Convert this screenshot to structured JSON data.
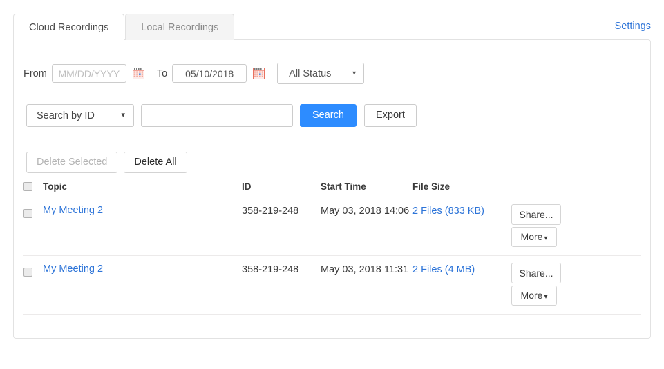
{
  "tabs": [
    {
      "label": "Cloud Recordings",
      "active": true
    },
    {
      "label": "Local Recordings",
      "active": false
    }
  ],
  "settings_link": "Settings",
  "filters": {
    "from_label": "From",
    "from_value": "",
    "from_placeholder": "MM/DD/YYYY",
    "to_label": "To",
    "to_value": "05/10/2018",
    "to_placeholder": "MM/DD/YYYY",
    "status_value": "All Status",
    "caret": "▾"
  },
  "search": {
    "search_by_value": "Search by  ID",
    "query_value": "",
    "query_placeholder": "",
    "search_button": "Search",
    "export_button": "Export",
    "caret": "▾"
  },
  "actions": {
    "delete_selected": "Delete Selected",
    "delete_all": "Delete All"
  },
  "table": {
    "headers": {
      "topic": "Topic",
      "id": "ID",
      "start_time": "Start Time",
      "file_size": "File Size"
    },
    "row_actions": {
      "share": "Share...",
      "more": "More",
      "more_caret": "▾"
    },
    "rows": [
      {
        "topic": "My Meeting 2",
        "id": "358-219-248",
        "start_time": "May 03, 2018 14:06",
        "file_size": "2 Files (833 KB)"
      },
      {
        "topic": "My Meeting 2",
        "id": "358-219-248",
        "start_time": "May 03, 2018 11:31",
        "file_size": "2 Files (4 MB)"
      }
    ]
  },
  "colors": {
    "primary_blue": "#2d8cff",
    "link_blue": "#2d74d8",
    "calendar_red": "#e8705f",
    "border_gray": "#e2e2e2"
  }
}
